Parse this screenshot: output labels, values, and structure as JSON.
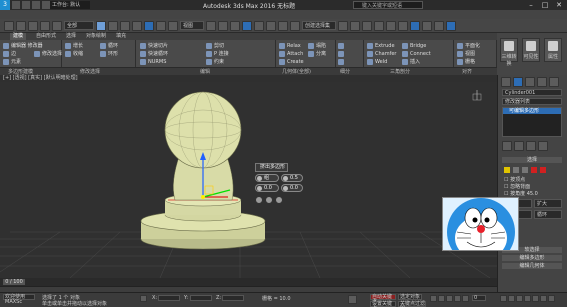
{
  "app": {
    "title": "Autodesk 3ds Max 2016",
    "document": "无标题",
    "project_dropdown": "工作台: 默认",
    "search_placeholder": "键入关键字或短语",
    "window_controls": [
      "–",
      "□",
      "✕"
    ]
  },
  "toolbar": {
    "selection_filter": "全部",
    "view_dropdown": "视图",
    "named_selection": "创建选择集"
  },
  "ribbon": {
    "tabs": [
      "建模",
      "自由形式",
      "选择",
      "对象绘制",
      "填充"
    ],
    "active_tab": 0,
    "groups": [
      {
        "label": "多边形建模",
        "rows": [
          "编辑器 修改器",
          "边",
          "元素",
          "修改选择"
        ]
      },
      {
        "label": "修改选择",
        "rows": [
          "增长",
          "收缩",
          "循环",
          "环形"
        ]
      },
      {
        "label": "编辑",
        "rows": [
          "快速切片",
          "快速循环",
          "NURMS",
          "剪切",
          "P 连接",
          "约束"
        ]
      },
      {
        "label": "几何体(全部)",
        "rows": [
          "Relax",
          "Attach",
          "Create",
          "塌陷",
          "分离",
          "Quickslice"
        ]
      },
      {
        "label": "细分",
        "rows": [
          "网格平滑",
          "细化",
          "使用置换"
        ]
      },
      {
        "label": "三角剖分",
        "rows": [
          "Extrude",
          "Chamfer",
          "Weld",
          "Bridge",
          "Connect",
          "插入"
        ]
      },
      {
        "label": "对齐",
        "rows": [
          "平面化",
          "视图",
          "栅格",
          "X Y Z"
        ]
      }
    ],
    "right_buttons": [
      "三维转换",
      "可见性",
      "属性"
    ]
  },
  "viewport": {
    "label": "[+] [透视] [真实] [默认明暗处理]",
    "caddy": {
      "title": "挤出多边形",
      "type": "组",
      "height": "0.5",
      "amount": "0.0",
      "outline": "0.0"
    },
    "axis": {
      "x": "X",
      "y": "Y",
      "z": "Z"
    }
  },
  "command_panel": {
    "object_name": "Cylinder001",
    "modifier_list_label": "修改器列表",
    "stack_item": "可编辑多边形",
    "section_title": "选择",
    "checkboxes": [
      "按顶点",
      "忽略背面",
      "按角度",
      "收缩",
      "扩大",
      "环形",
      "循环"
    ],
    "buttons": [
      "软选择",
      "编辑多边形",
      "编辑几何体"
    ],
    "angle_value": "45.0"
  },
  "timeline": {
    "frame_display": "0 / 100"
  },
  "status": {
    "selected_text": "选择了 1 个 对象",
    "prompt_text": "单击或单击并拖动以选择对象",
    "grid_text": "栅格 = 10.0",
    "x_label": "X:",
    "x_value": "",
    "y_label": "Y:",
    "y_value": "",
    "z_label": "Z:",
    "z_value": "",
    "autokey": "自动关键点",
    "selected_dd": "选定对象",
    "set_key": "设置关键点",
    "key_filters": "关键点过滤器...",
    "frame": "0",
    "welcome": "欢迎使用 MAXSc"
  },
  "colors": {
    "bg": "#3a3a3a",
    "viewport_bg": "#303030",
    "accent": "#2d6db5",
    "model": "#d9dca6",
    "gizmo_y": "#00e000",
    "gizmo_z": "#2060ff",
    "gizmo_x": "#e02020"
  }
}
